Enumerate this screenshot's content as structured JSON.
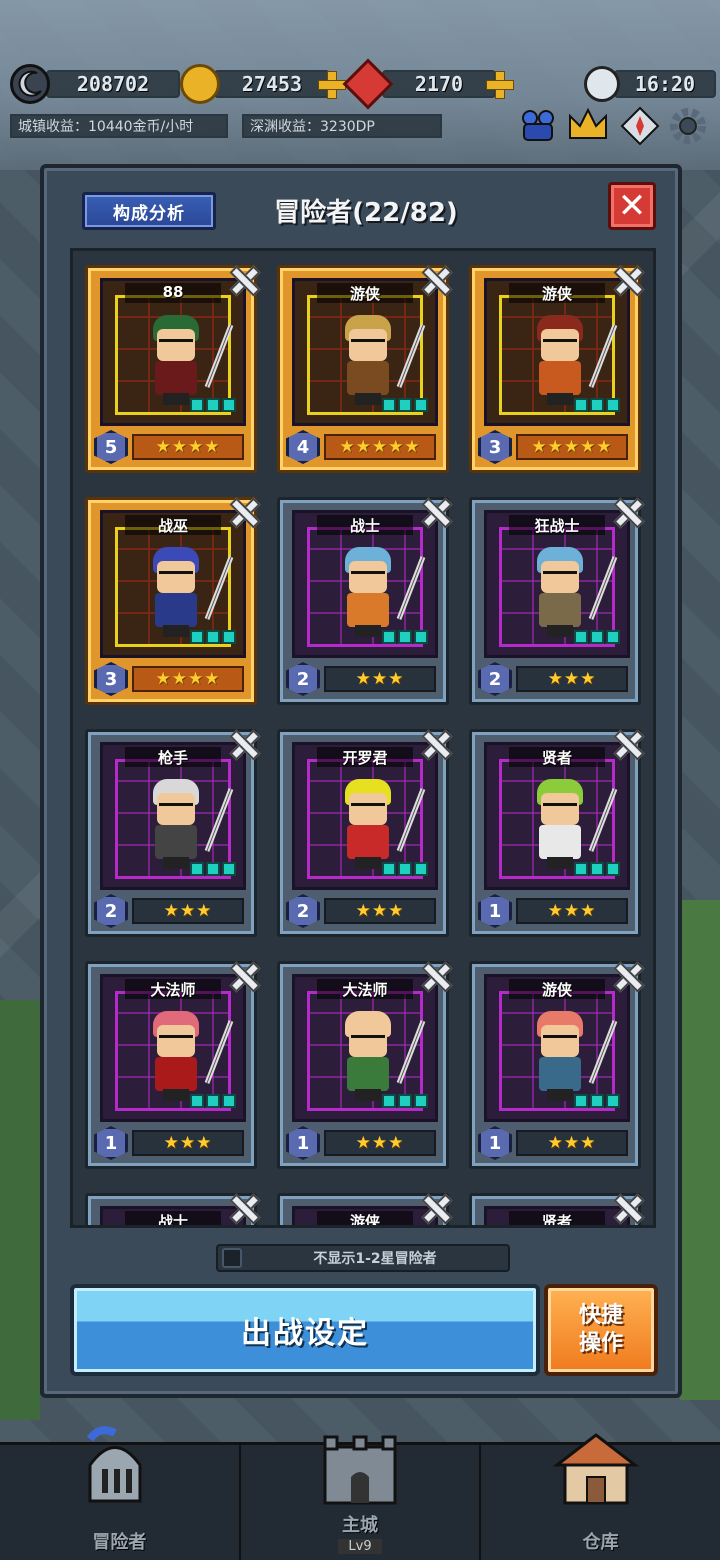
{
  "resources": {
    "moon": "208702",
    "gold": "27453",
    "gem": "2170",
    "time": "16:20"
  },
  "income": {
    "town": "城镇收益：10440金币/小时",
    "abyss": "深渊收益：3230DP"
  },
  "panel": {
    "analysis_label": "构成分析",
    "title": "冒险者(22/82)",
    "close_label": "✕",
    "toggle_label": "不显示1-2星冒险者",
    "deploy_label": "出战设定",
    "quick_label": "快捷操作"
  },
  "heroes": [
    {
      "class": "88",
      "level": "5",
      "stars": "★★★★",
      "rarity": "gold"
    },
    {
      "class": "游侠",
      "level": "4",
      "stars": "★★★★★",
      "rarity": "gold"
    },
    {
      "class": "游侠",
      "level": "3",
      "stars": "★★★★★",
      "rarity": "gold"
    },
    {
      "class": "战巫",
      "level": "3",
      "stars": "★★★★",
      "rarity": "gold"
    },
    {
      "class": "战士",
      "level": "2",
      "stars": "★★★",
      "rarity": "purple"
    },
    {
      "class": "狂战士",
      "level": "2",
      "stars": "★★★",
      "rarity": "purple"
    },
    {
      "class": "枪手",
      "level": "2",
      "stars": "★★★",
      "rarity": "purple"
    },
    {
      "class": "开罗君",
      "level": "2",
      "stars": "★★★",
      "rarity": "purple"
    },
    {
      "class": "贤者",
      "level": "1",
      "stars": "★★★",
      "rarity": "purple"
    },
    {
      "class": "大法师",
      "level": "1",
      "stars": "★★★",
      "rarity": "purple"
    },
    {
      "class": "大法师",
      "level": "1",
      "stars": "★★★",
      "rarity": "purple"
    },
    {
      "class": "游侠",
      "level": "1",
      "stars": "★★★",
      "rarity": "purple"
    },
    {
      "class": "战士"
    },
    {
      "class": "游侠"
    },
    {
      "class": "贤者"
    }
  ],
  "nav": {
    "adventurer": "冒险者",
    "castle": "主城",
    "castle_level": "Lv9",
    "warehouse": "仓库"
  },
  "colors": {
    "gold_card": "#e0962a",
    "purple_grid": "#b52ac8",
    "deploy_button": "#3c8fd8",
    "quick_button": "#ef7a1e",
    "close_button": "#d63a34"
  }
}
